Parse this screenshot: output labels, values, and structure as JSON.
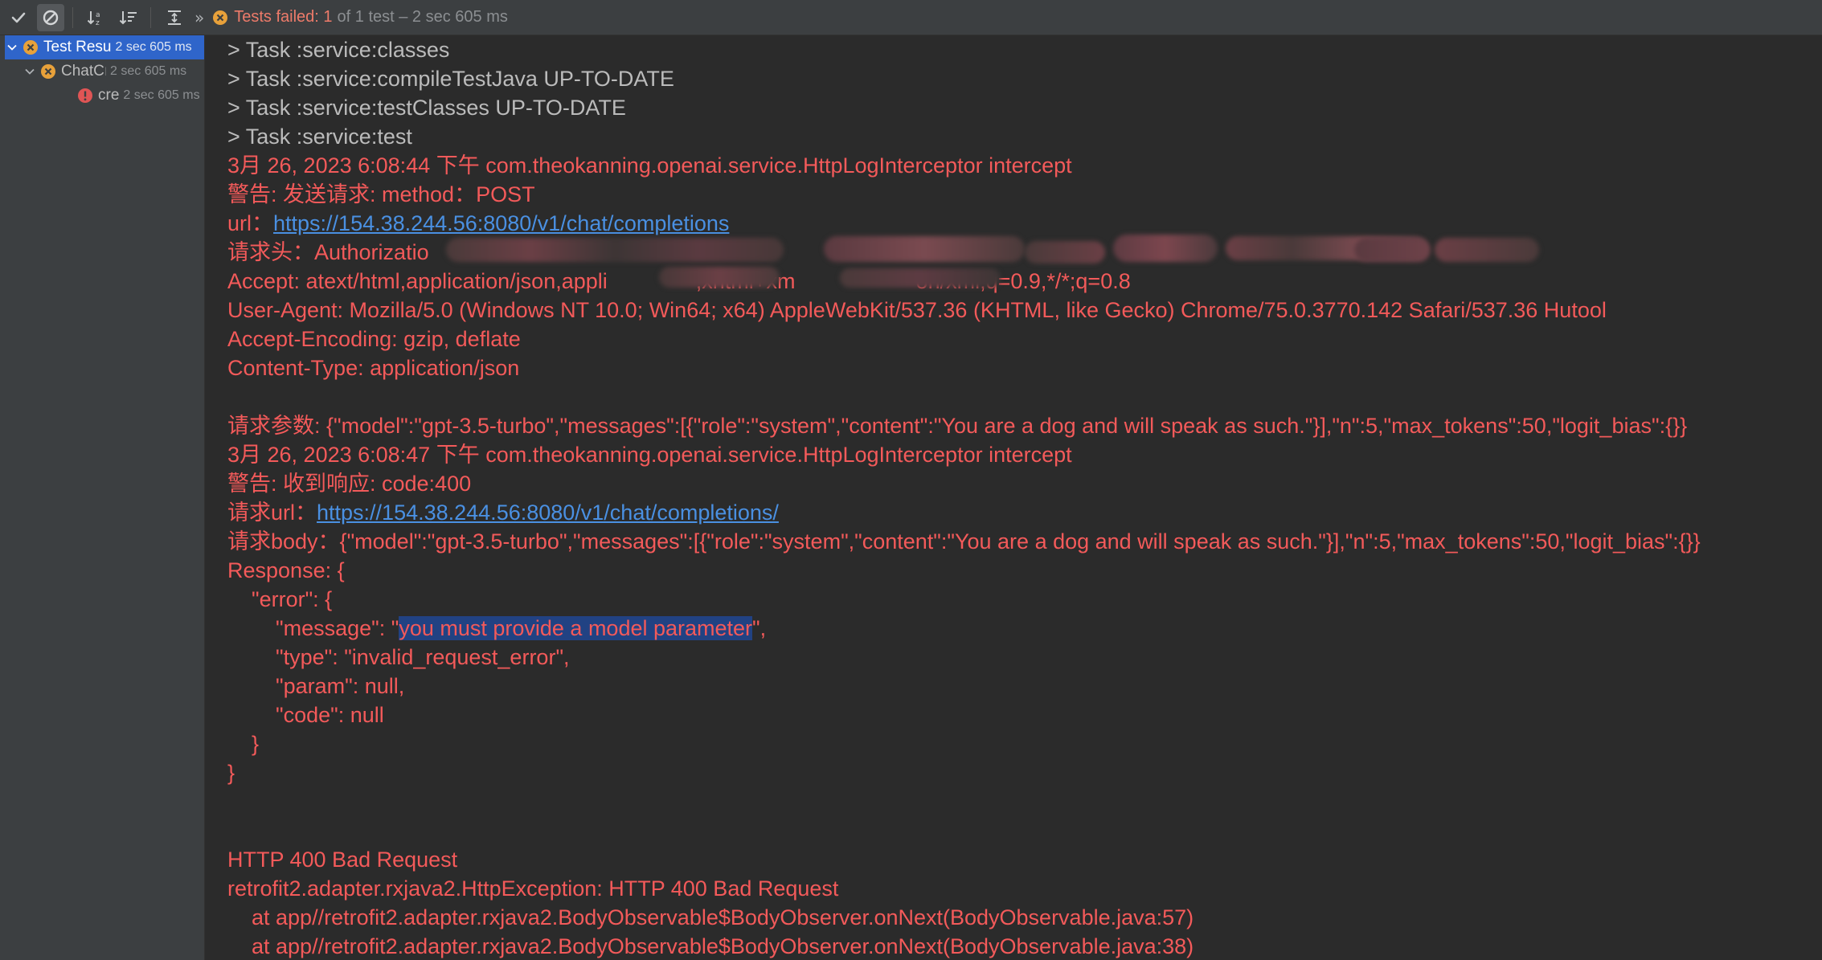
{
  "toolbar": {
    "status_failed": "Tests failed: 1",
    "status_rest": "of 1 test – 2 sec 605 ms",
    "more": "»"
  },
  "tree": {
    "items": [
      {
        "name": "Test Resu",
        "time": "2 sec 605 ms",
        "status": "failed",
        "expanded": true
      },
      {
        "name": "ChatCı",
        "time": "2 sec 605 ms",
        "status": "failed",
        "expanded": true
      },
      {
        "name": "cre",
        "time": "2 sec 605 ms",
        "status": "error"
      }
    ]
  },
  "console": {
    "lines": [
      {
        "text": "> Task :service:classes",
        "style": "gray"
      },
      {
        "text": "> Task :service:compileTestJava UP-TO-DATE",
        "style": "gray"
      },
      {
        "text": "> Task :service:testClasses UP-TO-DATE",
        "style": "gray"
      },
      {
        "text": "> Task :service:test",
        "style": "gray"
      },
      {
        "text": "3月 26, 2023 6:08:44 下午 com.theokanning.openai.service.HttpLogInterceptor intercept",
        "style": "red"
      },
      {
        "text": "警告: 发送请求: method：POST",
        "style": "red"
      },
      {
        "prefix": "url：",
        "link": "https://154.38.244.56:8080/v1/chat/completions",
        "style": "red"
      },
      {
        "text": "请求头：Authorizatio",
        "style": "red"
      },
      {
        "text": "Accept: atext/html,application/json,appli",
        "suffix": ",xhtml+xm",
        "tail": "on/xml;q=0.9,*/*;q=0.8",
        "style": "red"
      },
      {
        "text": "User-Agent: Mozilla/5.0 (Windows NT 10.0; Win64; x64) AppleWebKit/537.36 (KHTML, like Gecko) Chrome/75.0.3770.142 Safari/537.36 Hutool",
        "style": "red"
      },
      {
        "text": "Accept-Encoding: gzip, deflate",
        "style": "red"
      },
      {
        "text": "Content-Type: application/json",
        "style": "red"
      },
      {
        "text": "",
        "style": "red"
      },
      {
        "text": "请求参数: {\"model\":\"gpt-3.5-turbo\",\"messages\":[{\"role\":\"system\",\"content\":\"You are a dog and will speak as such.\"}],\"n\":5,\"max_tokens\":50,\"logit_bias\":{}}",
        "style": "red"
      },
      {
        "text": "3月 26, 2023 6:08:47 下午 com.theokanning.openai.service.HttpLogInterceptor intercept",
        "style": "red"
      },
      {
        "text": "警告: 收到响应: code:400",
        "style": "red"
      },
      {
        "prefix": "请求url：",
        "link": "https://154.38.244.56:8080/v1/chat/completions/",
        "style": "red"
      },
      {
        "text": "请求body：{\"model\":\"gpt-3.5-turbo\",\"messages\":[{\"role\":\"system\",\"content\":\"You are a dog and will speak as such.\"}],\"n\":5,\"max_tokens\":50,\"logit_bias\":{}}",
        "style": "red"
      },
      {
        "text": "Response: {",
        "style": "red"
      },
      {
        "text": "    \"error\": {",
        "style": "red"
      },
      {
        "prefix": "        \"message\": \"",
        "highlight": "you must provide a model parameter",
        "suffix": "\",",
        "style": "red"
      },
      {
        "text": "        \"type\": \"invalid_request_error\",",
        "style": "red"
      },
      {
        "text": "        \"param\": null,",
        "style": "red"
      },
      {
        "text": "        \"code\": null",
        "style": "red"
      },
      {
        "text": "    }",
        "style": "red"
      },
      {
        "text": "}",
        "style": "red"
      },
      {
        "text": "",
        "style": "red"
      },
      {
        "text": "",
        "style": "red"
      },
      {
        "text": "HTTP 400 Bad Request",
        "style": "red"
      },
      {
        "text": "retrofit2.adapter.rxjava2.HttpException: HTTP 400 Bad Request",
        "style": "red"
      },
      {
        "text": "    at app//retrofit2.adapter.rxjava2.BodyObservable$BodyObserver.onNext(BodyObservable.java:57)",
        "style": "red"
      },
      {
        "text": "    at app//retrofit2.adapter.rxjava2.BodyObservable$BodyObserver.onNext(BodyObservable.java:38)",
        "style": "red"
      }
    ]
  },
  "colors": {
    "error_text": "#f35a5a",
    "normal_text": "#bbbbbb",
    "link": "#4a90e2",
    "selection": "#214283",
    "tree_selected": "#2f65ca",
    "fail_icon": "#e8a13a",
    "error_icon": "#e05555"
  },
  "icons": {
    "toolbar": [
      "check-icon",
      "cancel-icon",
      "sort-alpha-icon",
      "sort-duration-icon",
      "expand-icon"
    ],
    "tree": [
      "chevron-down-icon",
      "test-failed-icon",
      "test-error-icon"
    ]
  }
}
